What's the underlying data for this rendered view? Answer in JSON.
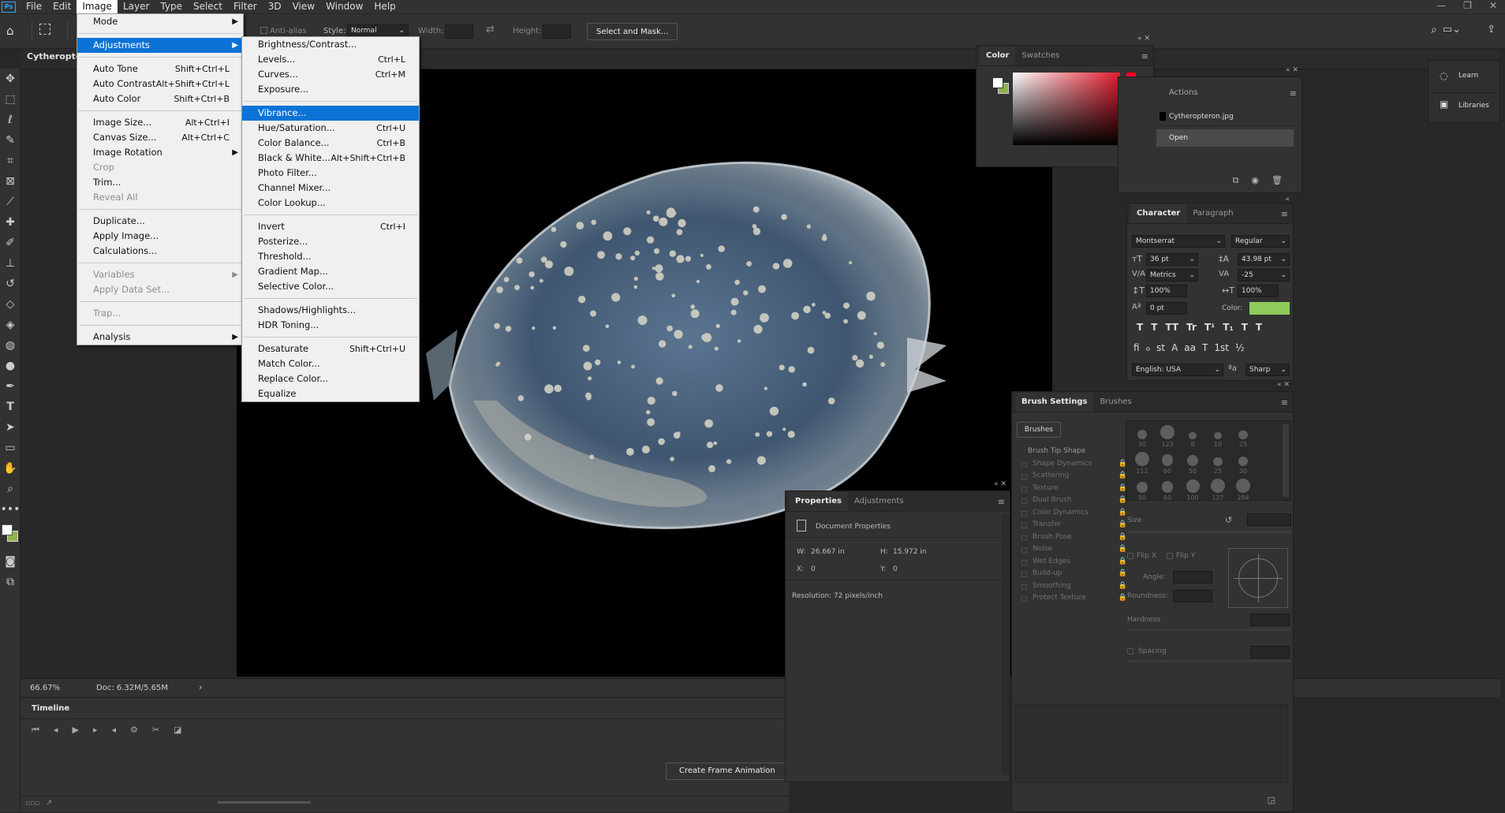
{
  "app": {
    "logo": "Ps"
  },
  "menubar": {
    "items": [
      "File",
      "Edit",
      "Image",
      "Layer",
      "Type",
      "Select",
      "Filter",
      "3D",
      "View",
      "Window",
      "Help"
    ]
  },
  "options_bar": {
    "antialias": "Anti-alias",
    "style_label": "Style:",
    "style_value": "Normal",
    "width_label": "Width:",
    "height_label": "Height:",
    "select_mask": "Select and Mask..."
  },
  "document": {
    "tab_title": "Cytheropte"
  },
  "image_menu": {
    "groups": [
      [
        {
          "label": "Mode",
          "shortcut": "",
          "submenu": true,
          "disabled": false
        }
      ],
      [
        {
          "label": "Adjustments",
          "shortcut": "",
          "submenu": true,
          "disabled": false,
          "highlighted": true
        }
      ],
      [
        {
          "label": "Auto Tone",
          "shortcut": "Shift+Ctrl+L"
        },
        {
          "label": "Auto Contrast",
          "shortcut": "Alt+Shift+Ctrl+L"
        },
        {
          "label": "Auto Color",
          "shortcut": "Shift+Ctrl+B"
        }
      ],
      [
        {
          "label": "Image Size...",
          "shortcut": "Alt+Ctrl+I"
        },
        {
          "label": "Canvas Size...",
          "shortcut": "Alt+Ctrl+C"
        },
        {
          "label": "Image Rotation",
          "shortcut": "",
          "submenu": true
        },
        {
          "label": "Crop",
          "shortcut": "",
          "disabled": true
        },
        {
          "label": "Trim...",
          "shortcut": ""
        },
        {
          "label": "Reveal All",
          "shortcut": "",
          "disabled": true
        }
      ],
      [
        {
          "label": "Duplicate...",
          "shortcut": ""
        },
        {
          "label": "Apply Image...",
          "shortcut": ""
        },
        {
          "label": "Calculations...",
          "shortcut": ""
        }
      ],
      [
        {
          "label": "Variables",
          "shortcut": "",
          "submenu": true,
          "disabled": true
        },
        {
          "label": "Apply Data Set...",
          "shortcut": "",
          "disabled": true
        }
      ],
      [
        {
          "label": "Trap...",
          "shortcut": "",
          "disabled": true
        }
      ],
      [
        {
          "label": "Analysis",
          "shortcut": "",
          "submenu": true
        }
      ]
    ]
  },
  "adjustments_menu": {
    "groups": [
      [
        {
          "label": "Brightness/Contrast...",
          "shortcut": ""
        },
        {
          "label": "Levels...",
          "shortcut": "Ctrl+L"
        },
        {
          "label": "Curves...",
          "shortcut": "Ctrl+M"
        },
        {
          "label": "Exposure...",
          "shortcut": ""
        }
      ],
      [
        {
          "label": "Vibrance...",
          "shortcut": "",
          "highlighted": true
        },
        {
          "label": "Hue/Saturation...",
          "shortcut": "Ctrl+U"
        },
        {
          "label": "Color Balance...",
          "shortcut": "Ctrl+B"
        },
        {
          "label": "Black & White...",
          "shortcut": "Alt+Shift+Ctrl+B"
        },
        {
          "label": "Photo Filter...",
          "shortcut": ""
        },
        {
          "label": "Channel Mixer...",
          "shortcut": ""
        },
        {
          "label": "Color Lookup...",
          "shortcut": ""
        }
      ],
      [
        {
          "label": "Invert",
          "shortcut": "Ctrl+I"
        },
        {
          "label": "Posterize...",
          "shortcut": ""
        },
        {
          "label": "Threshold...",
          "shortcut": ""
        },
        {
          "label": "Gradient Map...",
          "shortcut": ""
        },
        {
          "label": "Selective Color...",
          "shortcut": ""
        }
      ],
      [
        {
          "label": "Shadows/Highlights...",
          "shortcut": ""
        },
        {
          "label": "HDR Toning...",
          "shortcut": ""
        }
      ],
      [
        {
          "label": "Desaturate",
          "shortcut": "Shift+Ctrl+U"
        },
        {
          "label": "Match Color...",
          "shortcut": ""
        },
        {
          "label": "Replace Color...",
          "shortcut": ""
        },
        {
          "label": "Equalize",
          "shortcut": ""
        }
      ]
    ]
  },
  "color_panel": {
    "tabs": [
      "Color",
      "Swatches"
    ],
    "foreground": "#ffffff",
    "background": "#8fb34f"
  },
  "actions_panel": {
    "title": "Actions",
    "items": [
      "Cytheropteron.jpg",
      "Open"
    ]
  },
  "character_panel": {
    "tabs": [
      "Character",
      "Paragraph"
    ],
    "font": "Montserrat",
    "style": "Regular",
    "size": "36 pt",
    "leading": "43.98 pt",
    "kerning": "Metrics",
    "tracking": "-25",
    "vscale": "100%",
    "hscale": "100%",
    "baseline": "0 pt",
    "color_label": "Color:",
    "color": "#8fcb5a",
    "language": "English: USA",
    "antialias": "Sharp",
    "glyphs_a": [
      "T",
      "T",
      "TT",
      "Tr",
      "T¹",
      "T₁",
      "T",
      "T"
    ],
    "glyphs_b": [
      "fi",
      "ℴ",
      "st",
      "A",
      "aa",
      "T",
      "1st",
      "½"
    ]
  },
  "learn_panel": {
    "learn": "Learn",
    "libraries": "Libraries"
  },
  "brush_panel": {
    "tabs": [
      "Brush Settings",
      "Brushes"
    ],
    "brushes_btn": "Brushes",
    "options": [
      "Brush Tip Shape",
      "Shape Dynamics",
      "Scattering",
      "Texture",
      "Dual Brush",
      "Color Dynamics",
      "Transfer",
      "Brush Pose",
      "Noise",
      "Wet Edges",
      "Build-up",
      "Smoothing",
      "Protect Texture"
    ],
    "size_label": "Size",
    "flipx": "Flip X",
    "flipy": "Flip Y",
    "angle_label": "Angle:",
    "roundness_label": "Roundness:",
    "hardness_label": "Hardness",
    "spacing_label": "Spacing",
    "tip_sizes": [
      "30",
      "123",
      "8",
      "10",
      "25",
      "112",
      "60",
      "50",
      "25",
      "30",
      "50",
      "60",
      "100",
      "127",
      "284"
    ]
  },
  "properties_panel": {
    "tabs": [
      "Properties",
      "Adjustments"
    ],
    "title": "Document Properties",
    "w_label": "W:",
    "w": "26.667 in",
    "h_label": "H:",
    "h": "15.972 in",
    "x_label": "X:",
    "x": "0",
    "y_label": "Y:",
    "y": "0",
    "resolution": "Resolution: 72 pixels/inch"
  },
  "status": {
    "zoom": "66.67%",
    "doc": "Doc: 6.32M/5.65M"
  },
  "timeline": {
    "title": "Timeline",
    "create_btn": "Create Frame Animation"
  }
}
